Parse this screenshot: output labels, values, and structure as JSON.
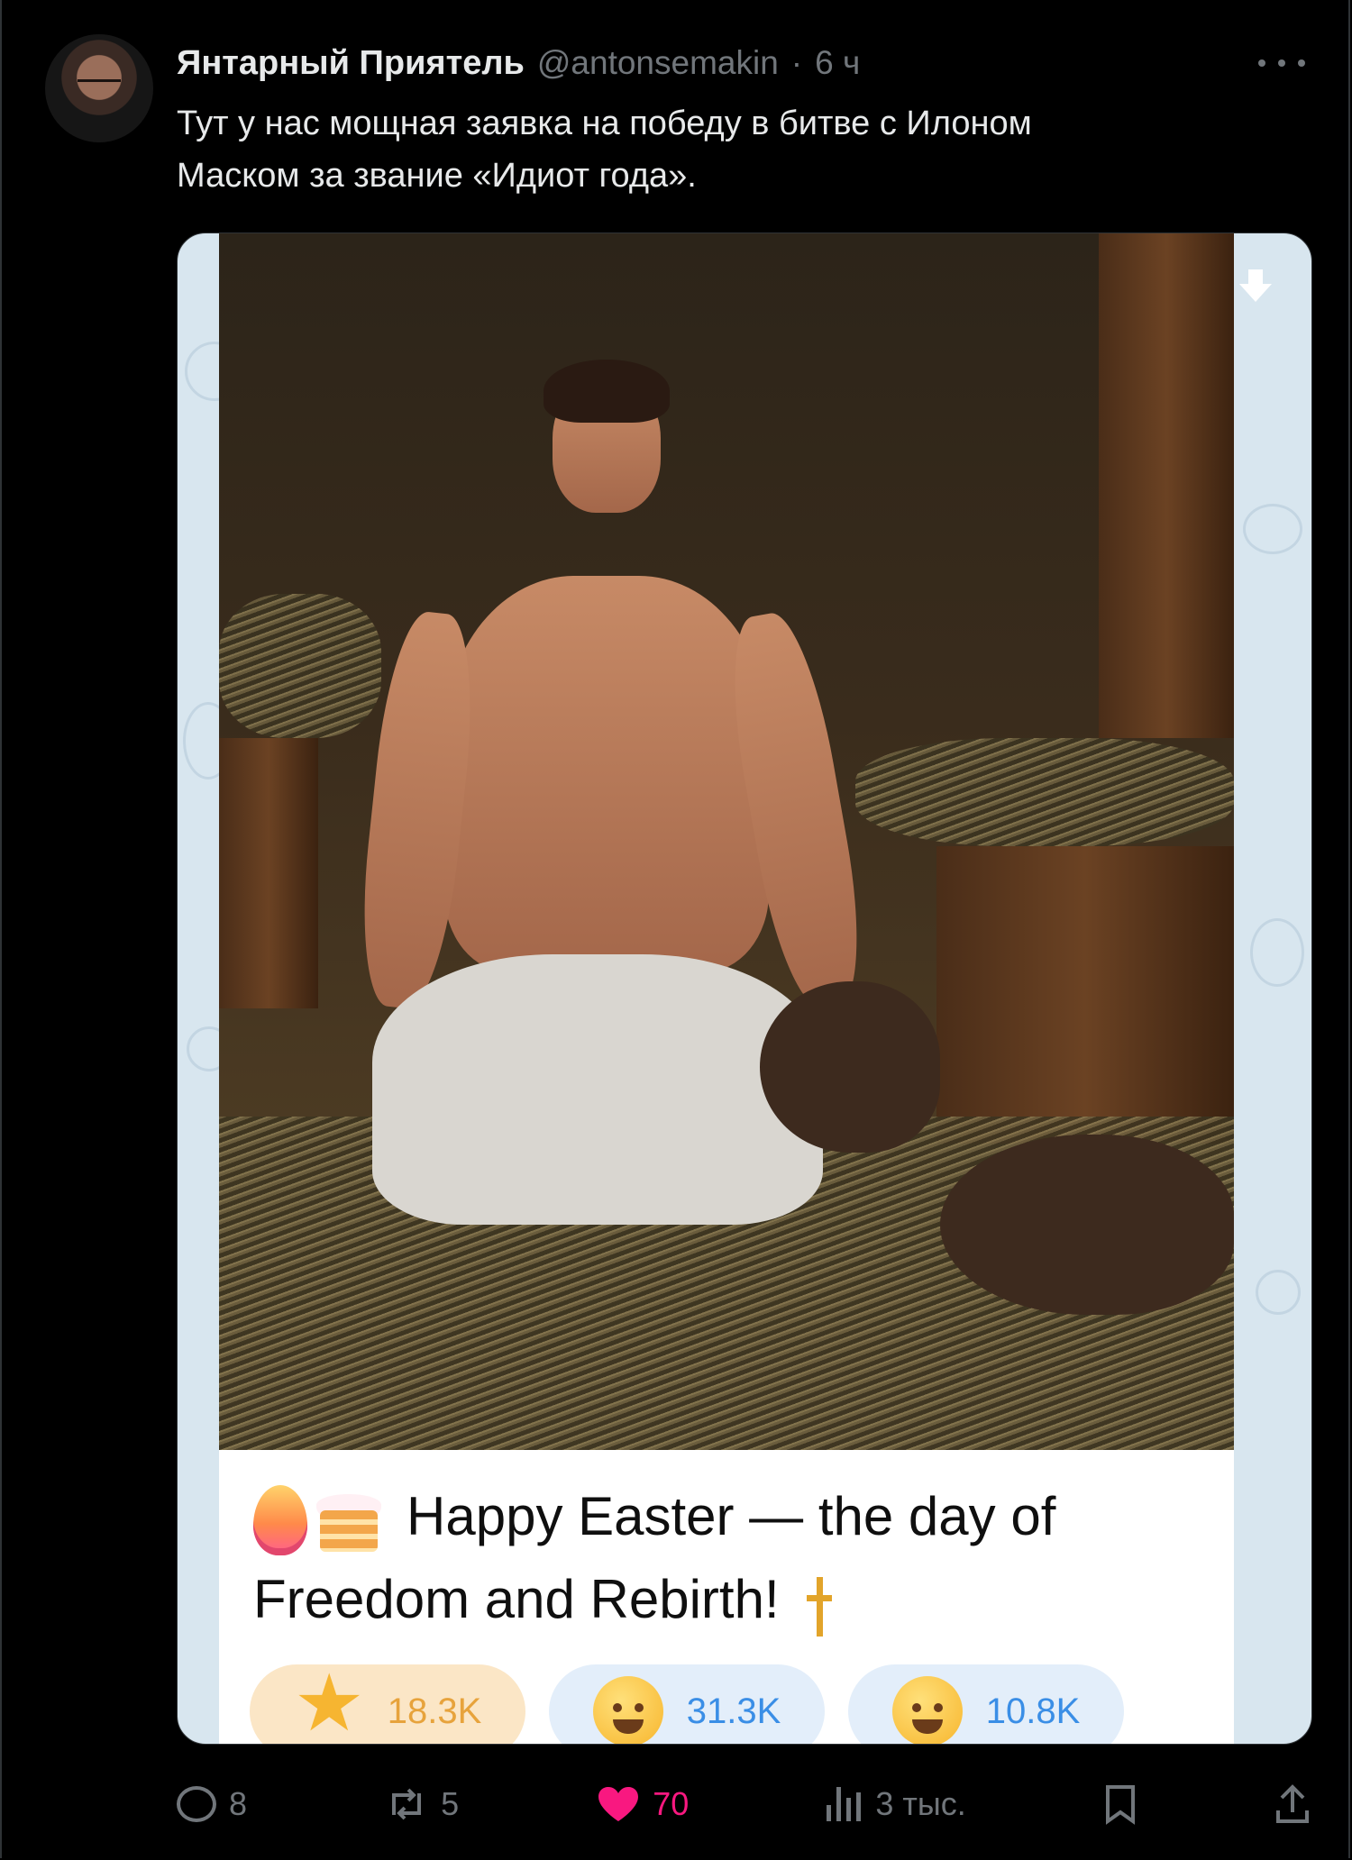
{
  "tweet": {
    "author_name": "Янтарный Приятель",
    "handle": "@antonsemakin",
    "separator": "·",
    "time": "6 ч",
    "text_line1": "Тут у нас мощная заявка на победу в битве с Илоном",
    "text_line2": "Маском за звание «Идиот года»."
  },
  "media": {
    "caption_line1": "Happy Easter — the day of",
    "caption_line2": "Freedom and Rebirth!",
    "reactions": [
      {
        "icon": "star-sparkle-icon",
        "count": "18.3K"
      },
      {
        "icon": "blushing-face-icon",
        "count": "31.3K"
      },
      {
        "icon": "laughing-face-icon",
        "count": "10.8K"
      }
    ]
  },
  "actions": {
    "replies": "8",
    "reposts": "5",
    "likes": "70",
    "views": "3 тыс."
  },
  "colors": {
    "background": "#000000",
    "text": "#e7e9ea",
    "muted": "#71767b",
    "like": "#f91880",
    "reaction_blue": "#3a8ee6",
    "reaction_gold": "#e7a33c"
  }
}
